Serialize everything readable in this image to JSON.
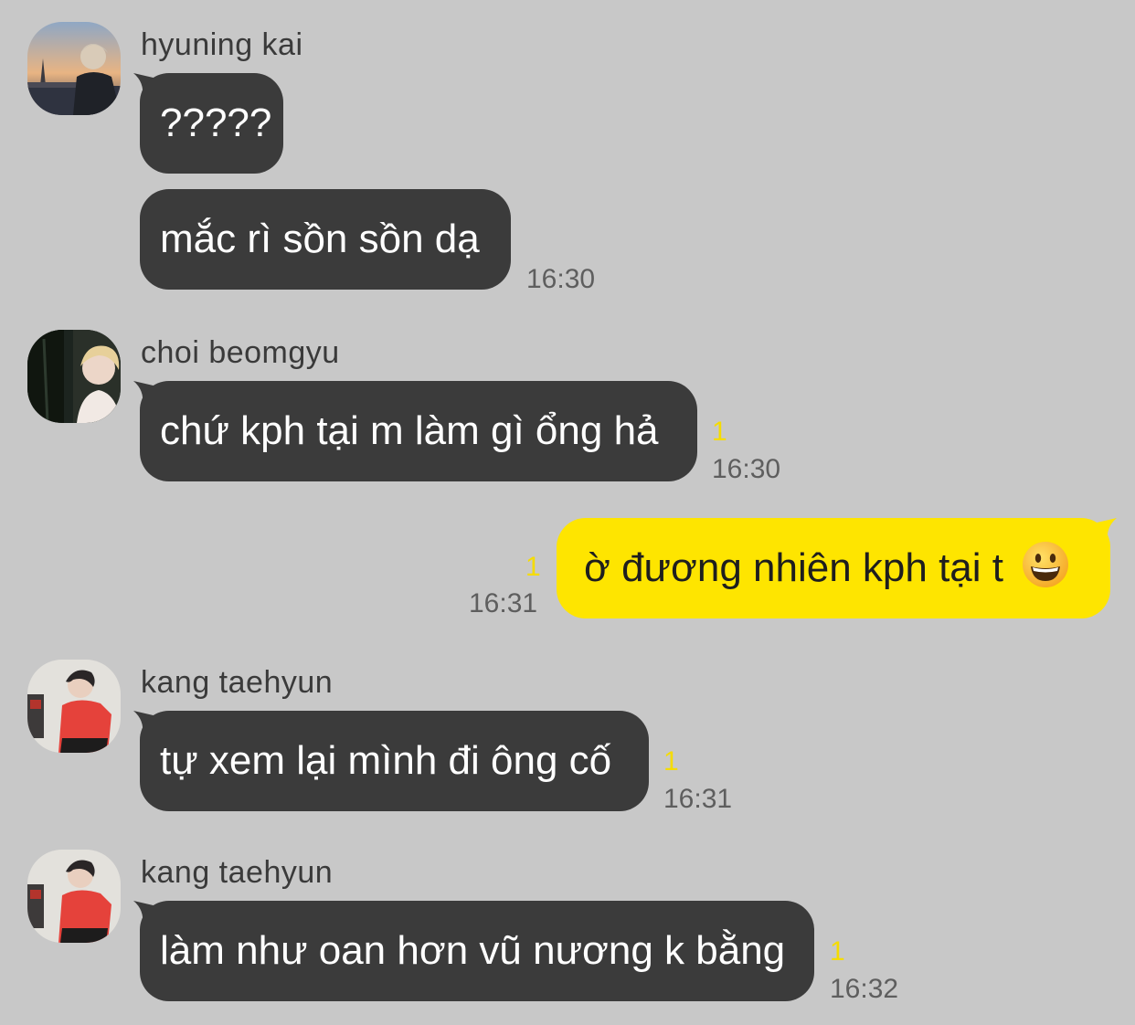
{
  "colors": {
    "background": "#c8c8c8",
    "incoming_bubble": "#3b3b3b",
    "outgoing_bubble": "#fee500",
    "unread_count": "#f5dc00",
    "timestamp": "#5e5e5e"
  },
  "messages": [
    {
      "sender": "hyuning kai",
      "avatar_icon": "sunset-photo-avatar",
      "bubbles": [
        "?????",
        "mắc rì sồn sồn dạ"
      ],
      "time": "16:30"
    },
    {
      "sender": "choi beomgyu",
      "avatar_icon": "dark-photo-avatar",
      "bubbles": [
        "chứ kph tại m làm gì ổng hả"
      ],
      "unread": "1",
      "time": "16:30"
    },
    {
      "outgoing": true,
      "bubbles": [
        "ờ đương nhiên kph tại t"
      ],
      "emoji_icon": "grinning-face-emoji",
      "unread": "1",
      "time": "16:31"
    },
    {
      "sender": "kang taehyun",
      "avatar_icon": "red-shirt-photo-avatar",
      "bubbles": [
        "tự xem lại mình đi ông cố"
      ],
      "unread": "1",
      "time": "16:31"
    },
    {
      "sender": "kang taehyun",
      "avatar_icon": "red-shirt-photo-avatar",
      "bubbles": [
        "làm như oan hơn vũ nương k bằng"
      ],
      "unread": "1",
      "time": "16:32"
    }
  ]
}
